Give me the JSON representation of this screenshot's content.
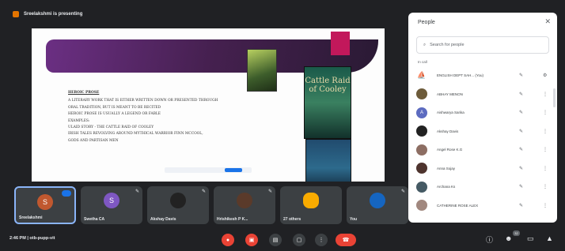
{
  "banner": {
    "text": "Sreelakshmi is presenting"
  },
  "slide": {
    "heading": "Heroic prose",
    "lines": [
      "A literary work that is either written down or presented through",
      "oral tradition, but is meant to be recited",
      "Heroic prose is usually a legend or fable",
      "Examples:",
      "Ulaid story - The Cattle Raid of Cooley",
      "Irish tales revolving around mythical warrior Finn McCool,",
      "gods and partisan men"
    ],
    "book_title": "Cattle Raid of Cooley"
  },
  "tiles": [
    {
      "name": "Sreelakshmi",
      "initial": "S",
      "avatar_color": "#c0582f",
      "active": true,
      "indicator": "hand-icon"
    },
    {
      "name": "Swetha CA",
      "initial": "S",
      "avatar_color": "#7e57c2",
      "active": false,
      "indicator": "mic-off-icon"
    },
    {
      "name": "Akshay Davis",
      "initial": "",
      "avatar_color": "#222222",
      "active": false,
      "indicator": "mic-off-icon"
    },
    {
      "name": "Hrishikesh P K...",
      "initial": "",
      "avatar_color": "#5a3a2a",
      "active": false,
      "indicator": "mic-off-icon"
    },
    {
      "name": "27 others",
      "initial": "",
      "avatar_color": "#3c4043",
      "active": false,
      "indicator": ""
    },
    {
      "name": "You",
      "initial": "",
      "avatar_color": "#1565c0",
      "active": false,
      "indicator": "mic-off-icon"
    }
  ],
  "bottom": {
    "time": "2:46 PM",
    "separator": "|",
    "meeting_code": "otb-pupp-vit",
    "people_count": "32"
  },
  "panel": {
    "title": "People",
    "search_placeholder": "Search for people",
    "section": "In call",
    "people": [
      {
        "name": "ENGLISH DEPT SAH... (You)",
        "avatar_color": "#1e88e5",
        "initial": ""
      },
      {
        "name": "ABHAY MENON",
        "avatar_color": "#6d5b3a",
        "initial": ""
      },
      {
        "name": "Aishwarya Sarika",
        "avatar_color": "#5c6bc0",
        "initial": "A"
      },
      {
        "name": "Akshay Davis",
        "avatar_color": "#222222",
        "initial": ""
      },
      {
        "name": "Angel Rose K.G",
        "avatar_color": "#8d6e63",
        "initial": ""
      },
      {
        "name": "Anna Sojay",
        "avatar_color": "#4e342e",
        "initial": ""
      },
      {
        "name": "Archana Ks",
        "avatar_color": "#455a64",
        "initial": ""
      },
      {
        "name": "CATHERINE ROSE ALEX",
        "avatar_color": "#a1887f",
        "initial": ""
      }
    ]
  },
  "colors": {
    "background": "#202124",
    "accent": "#1a73e8",
    "danger": "#ea4335"
  }
}
